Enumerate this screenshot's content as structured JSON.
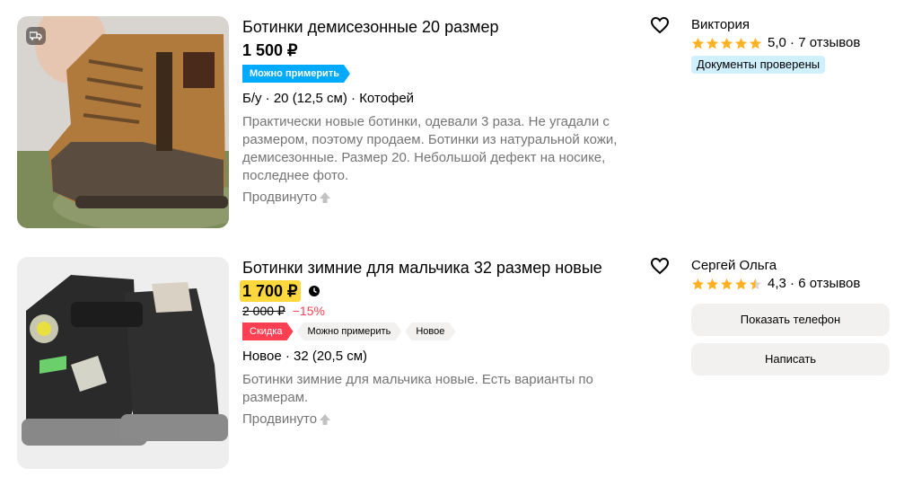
{
  "listings": [
    {
      "title": "Ботинки демисезонные 20 размер",
      "price": "1 500 ₽",
      "tags": [
        "Можно примерить"
      ],
      "params": "Б/у · 20 (12,5 см) · Котофей",
      "description": "Практически новые ботинки, одевали 3 раза. Не угадали с размером, поэтому продаем. Ботинки из натуральной кожи, демисезонные. Размер 20. Небольшой дефект на носике, последнее фото.",
      "promoted": "Продвинуто",
      "seller": {
        "name": "Виктория",
        "rating": "5,0",
        "reviews": "7 отзывов",
        "verified": "Документы проверены"
      },
      "stars_filled": 5
    },
    {
      "title": "Ботинки зимние для мальчика 32 размер новые",
      "price": "1 700 ₽",
      "old_price": "2 000 ₽",
      "discount": "−15%",
      "tags": [
        "Скидка",
        "Можно примерить",
        "Новое"
      ],
      "params": "Новое · 32 (20,5 см)",
      "description": "Ботинки зимние для мальчика новые. Есть варианты по размерам.",
      "promoted": "Продвинуто",
      "seller": {
        "name": "Сергей Ольга",
        "rating": "4,3",
        "reviews": "6 отзывов"
      },
      "stars_filled": 4.5,
      "buttons": {
        "phone": "Показать телефон",
        "write": "Написать"
      }
    }
  ],
  "colors": {
    "accent_blue": "#00aaff",
    "sale_red": "#ff4053",
    "price_highlight": "#ffd83d",
    "star": "#ffb021"
  }
}
